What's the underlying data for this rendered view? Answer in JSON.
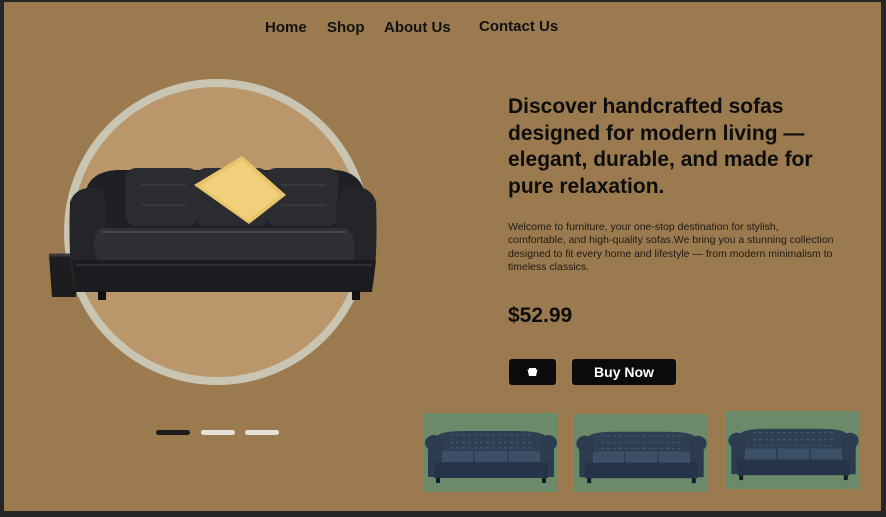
{
  "nav": {
    "home": "Home",
    "shop": "Shop",
    "about": "About Us",
    "contact": "Contact Us"
  },
  "hero": {
    "headline": "Discover handcrafted sofas designed for modern living — elegant, durable, and made for pure relaxation.",
    "description": "Welcome to  furniture, your one-stop destination for stylish, comfortable, and high-quality sofas.We bring you a stunning collection designed to fit every home and lifestyle — from modern minimalism to timeless classics.",
    "price": "$52.99",
    "cart_icon": "cart-icon",
    "buy_label": "Buy Now"
  },
  "carousel": {
    "active_index": 0,
    "count": 3
  },
  "thumbnails": [
    {
      "name": "navy-chesterfield-sofa-1"
    },
    {
      "name": "navy-chesterfield-sofa-2"
    },
    {
      "name": "navy-chesterfield-sofa-3"
    }
  ],
  "colors": {
    "background": "#9b7a50",
    "circle_fill": "#b9976a",
    "circle_ring": "#c9c5b3",
    "button": "#0b0b0b",
    "thumb_bg": "#6a8a6a",
    "dot_active": "#1c1c1c",
    "dot_inactive": "#e6e2d8"
  }
}
